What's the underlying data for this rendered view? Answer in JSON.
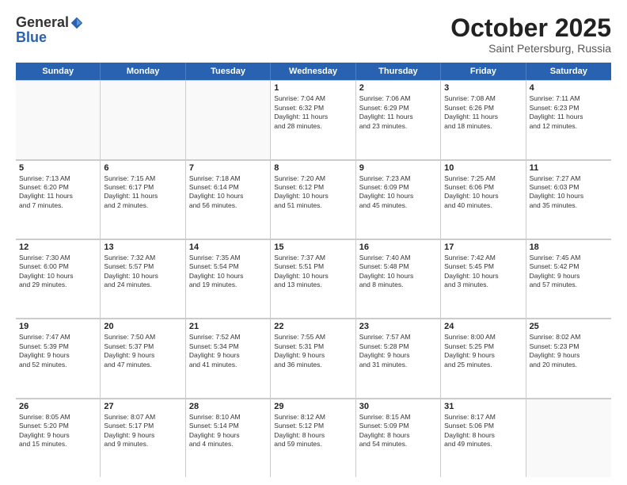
{
  "header": {
    "logo_general": "General",
    "logo_blue": "Blue",
    "month_title": "October 2025",
    "subtitle": "Saint Petersburg, Russia"
  },
  "weekdays": [
    "Sunday",
    "Monday",
    "Tuesday",
    "Wednesday",
    "Thursday",
    "Friday",
    "Saturday"
  ],
  "rows": [
    [
      {
        "day": "",
        "info": ""
      },
      {
        "day": "",
        "info": ""
      },
      {
        "day": "",
        "info": ""
      },
      {
        "day": "1",
        "info": "Sunrise: 7:04 AM\nSunset: 6:32 PM\nDaylight: 11 hours\nand 28 minutes."
      },
      {
        "day": "2",
        "info": "Sunrise: 7:06 AM\nSunset: 6:29 PM\nDaylight: 11 hours\nand 23 minutes."
      },
      {
        "day": "3",
        "info": "Sunrise: 7:08 AM\nSunset: 6:26 PM\nDaylight: 11 hours\nand 18 minutes."
      },
      {
        "day": "4",
        "info": "Sunrise: 7:11 AM\nSunset: 6:23 PM\nDaylight: 11 hours\nand 12 minutes."
      }
    ],
    [
      {
        "day": "5",
        "info": "Sunrise: 7:13 AM\nSunset: 6:20 PM\nDaylight: 11 hours\nand 7 minutes."
      },
      {
        "day": "6",
        "info": "Sunrise: 7:15 AM\nSunset: 6:17 PM\nDaylight: 11 hours\nand 2 minutes."
      },
      {
        "day": "7",
        "info": "Sunrise: 7:18 AM\nSunset: 6:14 PM\nDaylight: 10 hours\nand 56 minutes."
      },
      {
        "day": "8",
        "info": "Sunrise: 7:20 AM\nSunset: 6:12 PM\nDaylight: 10 hours\nand 51 minutes."
      },
      {
        "day": "9",
        "info": "Sunrise: 7:23 AM\nSunset: 6:09 PM\nDaylight: 10 hours\nand 45 minutes."
      },
      {
        "day": "10",
        "info": "Sunrise: 7:25 AM\nSunset: 6:06 PM\nDaylight: 10 hours\nand 40 minutes."
      },
      {
        "day": "11",
        "info": "Sunrise: 7:27 AM\nSunset: 6:03 PM\nDaylight: 10 hours\nand 35 minutes."
      }
    ],
    [
      {
        "day": "12",
        "info": "Sunrise: 7:30 AM\nSunset: 6:00 PM\nDaylight: 10 hours\nand 29 minutes."
      },
      {
        "day": "13",
        "info": "Sunrise: 7:32 AM\nSunset: 5:57 PM\nDaylight: 10 hours\nand 24 minutes."
      },
      {
        "day": "14",
        "info": "Sunrise: 7:35 AM\nSunset: 5:54 PM\nDaylight: 10 hours\nand 19 minutes."
      },
      {
        "day": "15",
        "info": "Sunrise: 7:37 AM\nSunset: 5:51 PM\nDaylight: 10 hours\nand 13 minutes."
      },
      {
        "day": "16",
        "info": "Sunrise: 7:40 AM\nSunset: 5:48 PM\nDaylight: 10 hours\nand 8 minutes."
      },
      {
        "day": "17",
        "info": "Sunrise: 7:42 AM\nSunset: 5:45 PM\nDaylight: 10 hours\nand 3 minutes."
      },
      {
        "day": "18",
        "info": "Sunrise: 7:45 AM\nSunset: 5:42 PM\nDaylight: 9 hours\nand 57 minutes."
      }
    ],
    [
      {
        "day": "19",
        "info": "Sunrise: 7:47 AM\nSunset: 5:39 PM\nDaylight: 9 hours\nand 52 minutes."
      },
      {
        "day": "20",
        "info": "Sunrise: 7:50 AM\nSunset: 5:37 PM\nDaylight: 9 hours\nand 47 minutes."
      },
      {
        "day": "21",
        "info": "Sunrise: 7:52 AM\nSunset: 5:34 PM\nDaylight: 9 hours\nand 41 minutes."
      },
      {
        "day": "22",
        "info": "Sunrise: 7:55 AM\nSunset: 5:31 PM\nDaylight: 9 hours\nand 36 minutes."
      },
      {
        "day": "23",
        "info": "Sunrise: 7:57 AM\nSunset: 5:28 PM\nDaylight: 9 hours\nand 31 minutes."
      },
      {
        "day": "24",
        "info": "Sunrise: 8:00 AM\nSunset: 5:25 PM\nDaylight: 9 hours\nand 25 minutes."
      },
      {
        "day": "25",
        "info": "Sunrise: 8:02 AM\nSunset: 5:23 PM\nDaylight: 9 hours\nand 20 minutes."
      }
    ],
    [
      {
        "day": "26",
        "info": "Sunrise: 8:05 AM\nSunset: 5:20 PM\nDaylight: 9 hours\nand 15 minutes."
      },
      {
        "day": "27",
        "info": "Sunrise: 8:07 AM\nSunset: 5:17 PM\nDaylight: 9 hours\nand 9 minutes."
      },
      {
        "day": "28",
        "info": "Sunrise: 8:10 AM\nSunset: 5:14 PM\nDaylight: 9 hours\nand 4 minutes."
      },
      {
        "day": "29",
        "info": "Sunrise: 8:12 AM\nSunset: 5:12 PM\nDaylight: 8 hours\nand 59 minutes."
      },
      {
        "day": "30",
        "info": "Sunrise: 8:15 AM\nSunset: 5:09 PM\nDaylight: 8 hours\nand 54 minutes."
      },
      {
        "day": "31",
        "info": "Sunrise: 8:17 AM\nSunset: 5:06 PM\nDaylight: 8 hours\nand 49 minutes."
      },
      {
        "day": "",
        "info": ""
      }
    ]
  ]
}
